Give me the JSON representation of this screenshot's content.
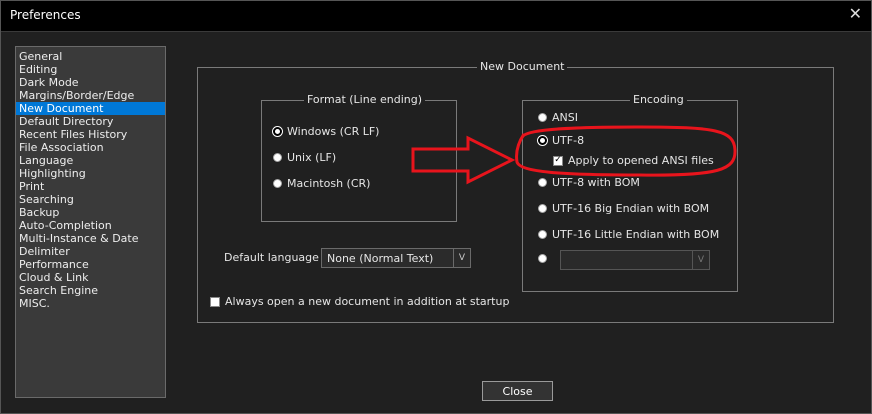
{
  "window": {
    "title": "Preferences",
    "close_glyph": "✕"
  },
  "sidebar": {
    "items": [
      {
        "label": "General"
      },
      {
        "label": "Editing"
      },
      {
        "label": "Dark Mode"
      },
      {
        "label": "Margins/Border/Edge"
      },
      {
        "label": "New Document",
        "selected": true
      },
      {
        "label": "Default Directory"
      },
      {
        "label": "Recent Files History"
      },
      {
        "label": "File Association"
      },
      {
        "label": "Language"
      },
      {
        "label": "Highlighting"
      },
      {
        "label": "Print"
      },
      {
        "label": "Searching"
      },
      {
        "label": "Backup"
      },
      {
        "label": "Auto-Completion"
      },
      {
        "label": "Multi-Instance & Date"
      },
      {
        "label": "Delimiter"
      },
      {
        "label": "Performance"
      },
      {
        "label": "Cloud & Link"
      },
      {
        "label": "Search Engine"
      },
      {
        "label": "MISC."
      }
    ]
  },
  "new_document": {
    "group_title": "New Document",
    "format": {
      "title": "Format (Line ending)",
      "options": [
        "Windows (CR LF)",
        "Unix (LF)",
        "Macintosh (CR)"
      ],
      "selected": "Windows (CR LF)"
    },
    "encoding": {
      "title": "Encoding",
      "options": [
        "ANSI",
        "UTF-8",
        "UTF-8 with BOM",
        "UTF-16 Big Endian with BOM",
        "UTF-16 Little Endian with BOM"
      ],
      "selected": "UTF-8",
      "apply_ansi_label": "Apply to opened ANSI files",
      "apply_ansi_checked": true,
      "codepage_value": ""
    },
    "default_language": {
      "label": "Default language :",
      "value": "None (Normal Text)",
      "arrow": "V"
    },
    "always_open": {
      "label": "Always open a new document in addition at startup",
      "checked": false
    }
  },
  "footer": {
    "close_label": "Close"
  },
  "annotation": {
    "color": "#e8141c"
  }
}
